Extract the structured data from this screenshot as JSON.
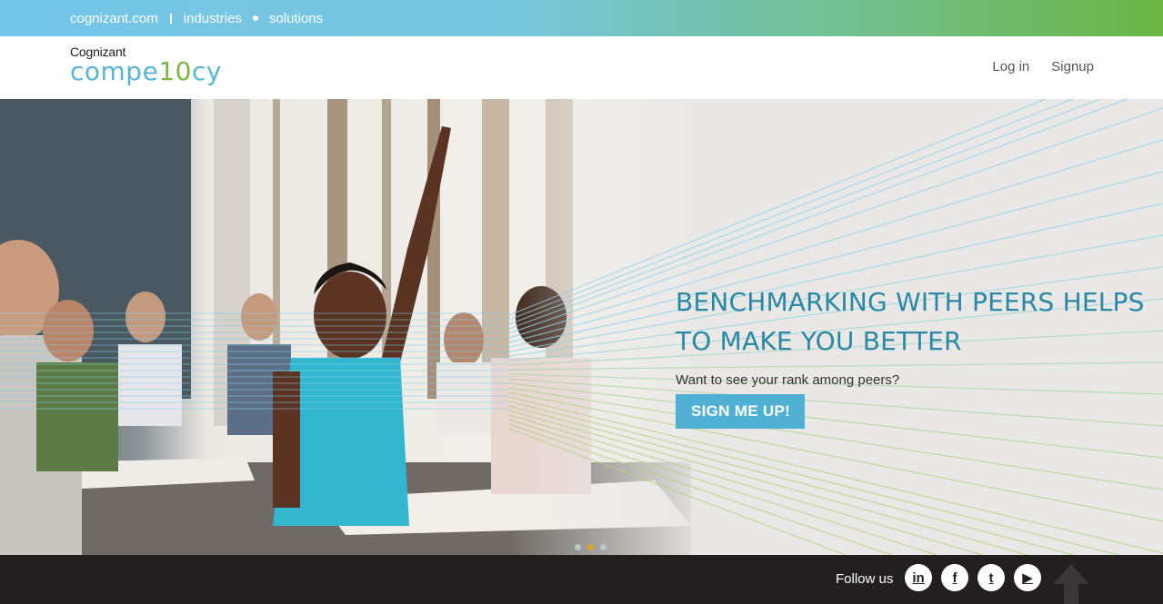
{
  "topbar": {
    "links": [
      "cognizant.com",
      "industries",
      "solutions"
    ]
  },
  "header": {
    "brand": "Cognizant",
    "product_prefix": "compe",
    "product_highlight": "10",
    "product_suffix": "cy",
    "nav": {
      "login": "Log in",
      "signup": "Signup"
    }
  },
  "hero": {
    "headline_line1": "BENCHMARKING WITH PEERS HELPS",
    "headline_line2": "TO MAKE YOU BETTER",
    "subline": "Want to see your rank among peers?",
    "cta": "SIGN ME UP!",
    "carousel": {
      "count": 3,
      "active": 2
    }
  },
  "footer": {
    "follow_label": "Follow us",
    "social": [
      {
        "name": "linkedin-icon",
        "glyph": "in"
      },
      {
        "name": "facebook-icon",
        "glyph": "f"
      },
      {
        "name": "twitter-icon",
        "glyph": "t"
      },
      {
        "name": "youtube-icon",
        "glyph": "▶"
      }
    ]
  },
  "colors": {
    "headline": "#2a88a6",
    "cta_bg": "#4fb0d3",
    "footer_bg": "#231f20",
    "logo_blue": "#58b5d6",
    "logo_green": "#7ab648"
  }
}
